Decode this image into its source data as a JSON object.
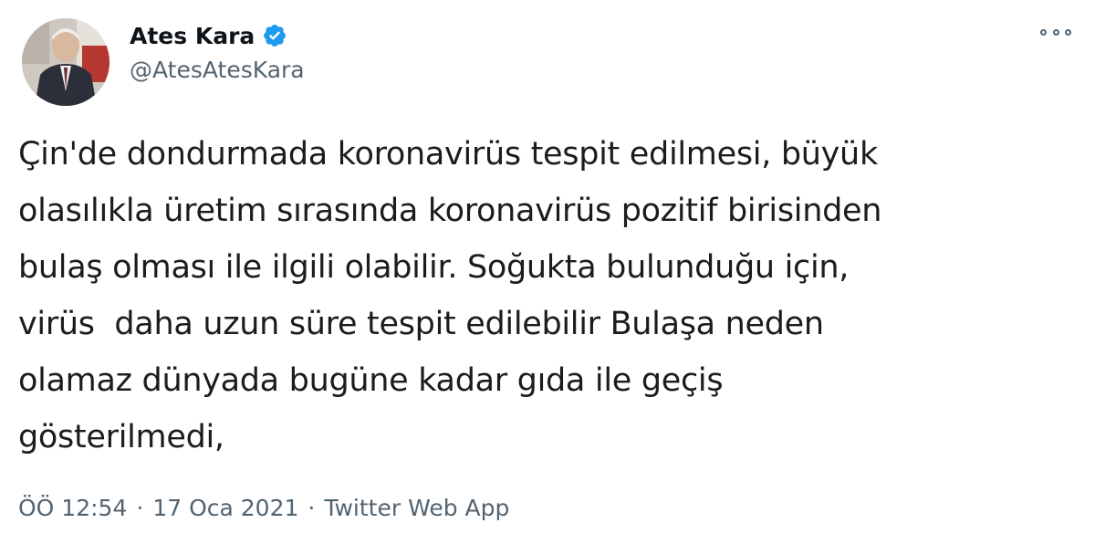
{
  "author": {
    "display_name": "Ates Kara",
    "handle": "@AtesAtesKara",
    "verified_icon": "verified-badge-icon",
    "avatar_icon": "avatar-photo"
  },
  "menu": {
    "more_icon": "more-options-icon"
  },
  "tweet": {
    "text": "Çin'de dondurmada koronavirüs tespit edilmesi, büyük\nolasılıkla üretim sırasında koronavirüs pozitif birisinden\nbulaş olması ile ilgili olabilir. Soğukta bulunduğu için,\nvirüs  daha uzun süre tespit edilebilir Bulaşa neden\nolamaz dünyada bugüne kadar gıda ile geçiş\ngösterilmedi,",
    "time": "ÖÖ 12:54",
    "separator": "·",
    "date": "17 Oca 2021",
    "source": "Twitter Web App"
  },
  "colors": {
    "verified_blue": "#1d9bf0",
    "secondary_text": "#536471",
    "primary_text": "#0f1419"
  }
}
